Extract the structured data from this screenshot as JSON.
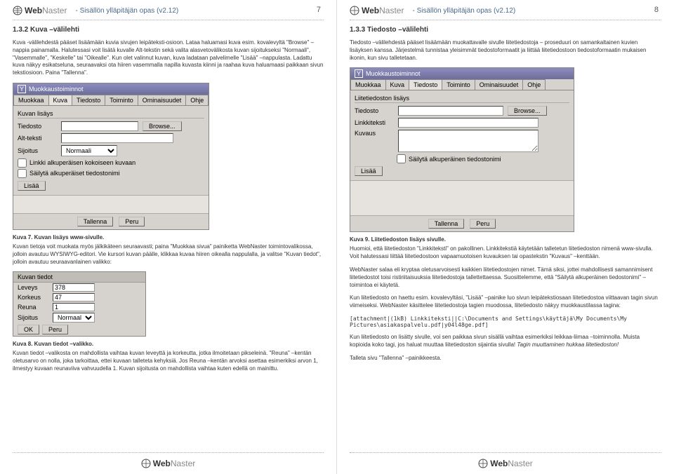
{
  "brand": {
    "logo_main": "Web",
    "logo_sub": "Naster"
  },
  "header_title": "- Sisällön ylläpitäjän opas (v2.12)",
  "page_left_num": "7",
  "page_right_num": "8",
  "left": {
    "section": "1.3.2 Kuva –välilehti",
    "p1": "Kuva -välilehdestä pääset lisäämään kuvia sivujen leipäteksti-osioon. Lataa haluamasi kuva esim. kovalevyltä \"Browse\" –nappia painamalla. Halutessasi voit lisätä kuvalle Alt-tekstin sekä valita alasvetovälikosta kuvan sijoitukseksi \"Normaali\", \"Vasemmalle\", \"Keskelle\" tai \"Oikealle\". Kun olet valinnut kuvan, kuva ladataan palvelimelle \"Lisää\" –nappulasta. Ladattu kuva näkyy esikatseluna, seuraavaksi ota hiiren vasemmalla napilla kuvasta kiinni ja raahaa kuva haluamaasi paikkaan sivun tekstiosioon. Paina \"Tallenna\".",
    "dialog1": {
      "title": "Muokkaustoiminnot",
      "tabs": [
        "Muokkaa",
        "Kuva",
        "Tiedosto",
        "Toiminto",
        "Ominaisuudet",
        "Ohje"
      ],
      "group": "Kuvan lisäys",
      "file_label": "Tiedosto",
      "browse": "Browse...",
      "alt_label": "Alt-teksti",
      "sijoitus_label": "Sijoitus",
      "sijoitus_value": "Normaali",
      "chk1": "Linkki alkuperäisen kokoiseen kuvaan",
      "chk2": "Säilytä alkuperäiset tiedostonimi",
      "lisaa": "Lisää",
      "tallenna": "Tallenna",
      "peru": "Peru"
    },
    "cap7": "Kuva 7. Kuvan lisäys www-sivulle.",
    "p2": "Kuvan tietoja voit muokata myös jälkikäteen seuraavasti; paina \"Muokkaa sivua\" painiketta WebNaster toimintovalikossa, jolloin avautuu WYSIWYG-editori. Vie kursori kuvan päälle, klikkaa kuvaa hiiren oikealla nappulalla, ja valitse \"Kuvan tiedot\", jolloin avautuu seuraavanlainen valikko:",
    "dialog2": {
      "title": "Kuvan tiedot",
      "leveys_label": "Leveys",
      "leveys_value": "378",
      "korkeus_label": "Korkeus",
      "korkeus_value": "47",
      "reuna_label": "Reuna",
      "reuna_value": "1",
      "sijoitus_label": "Sijoitus",
      "sijoitus_value": "Normaali",
      "ok": "OK",
      "peru": "Peru"
    },
    "cap8": "Kuva 8. Kuvan tiedot –valikko.",
    "p3": "Kuvan tiedot –valikosta on mahdollista vaihtaa kuvan leveyttä ja korkeutta, jotka ilmoitetaan pikseleinä. \"Reuna\" –kentän oletusarvo on nolla, joka tarkoittaa, ettei kuvaan talleteta kehyksiä. Jos Reuna –kentän arvoksi asettaa esimerkiksi arvon 1, ilmestyy kuvaan reunaviiva vahvuudella 1. Kuvan sijoitusta on mahdollista vaihtaa kuten edellä on mainittu."
  },
  "right": {
    "section": "1.3.3 Tiedosto –välilehti",
    "p1": "Tiedosto –välilehdestä pääset lisäämään muokattavalle sivulle liitetiedostoja – proseduuri on samankaltainen kuvien lisäyksen kanssa. Järjestelmä tunnistaa yleisimmät tiedostoformaatit ja liittää liitetiedostoon tiedostoformaatin mukaisen ikonin, kun sivu talletetaan.",
    "dialog1": {
      "title": "Muokkaustoiminnot",
      "tabs": [
        "Muokkaa",
        "Kuva",
        "Tiedosto",
        "Toiminto",
        "Ominaisuudet",
        "Ohje"
      ],
      "group": "Liitetiedoston lisäys",
      "file_label": "Tiedosto",
      "browse": "Browse...",
      "link_label": "Linkkiteksti",
      "kuvaus_label": "Kuvaus",
      "chk1": "Säilytä alkuperäinen tiedostonimi",
      "lisaa": "Lisää",
      "tallenna": "Tallenna",
      "peru": "Peru"
    },
    "cap9": "Kuva 9. Liitetiedoston lisäys sivulle.",
    "p2a": "Huomioi, että liitetiedoston \"Linkkiteksti\" on pakollinen. Linkkitekstiä käytetään talletetun liitetiedoston nimenä www-sivulla. Voit halutessasi liittää liitetiedostoon vapaamuotoisen kuvauksen tai opastekstin \"Kuvaus\" –kenttään.",
    "p2b": "WebNaster salaa eli kryptaa oletusarvoisesti kaikkien liitetiedostojen nimet. Tämä siksi, jottei mahdollisesti samannimisent liitetiedostot toisi ristiriitaisuuksia liitetiedostoja tallettettaessa. Suosittelemme, että \"Säilytä alkuperäinen tiedostonimi\" –toimintoa ei käytetä.",
    "p2c": "Kun liitetiedosto on haettu esim. kovalevyltäsi, \"Lisää\" –painike luo sivun leipätekstiosaan liitetiedostoa viittaavan tagin sivun viimeiseksi. WebNaster käsittelee liitetiedostoja tagien muodossa, liitetiedosto näkyy muokkaustilassa tagina:",
    "code": "[attachment|(1kB) Linkkiteksti||C:\\Documents and Settings\\käyttäjä\\My Documents\\My Pictures\\asiakaspalvelu.pdf|y04l48ge.pdf]",
    "p3a": "Kun liitetiedosto on lisätty sivulle, voi sen paikkaa sivun sisällä vaihtaa esimerkiksi leikkaa-liimaa –toiminnolla. Muista kopioida koko tagi, jos haluat muuttaa liitetiedoston sijaintia sivulla!",
    "p3b": "Tagin muuttaminen hukkaa liitetiedoston!",
    "p3c": "Talleta sivu \"Tallenna\" –painikkeesta."
  }
}
